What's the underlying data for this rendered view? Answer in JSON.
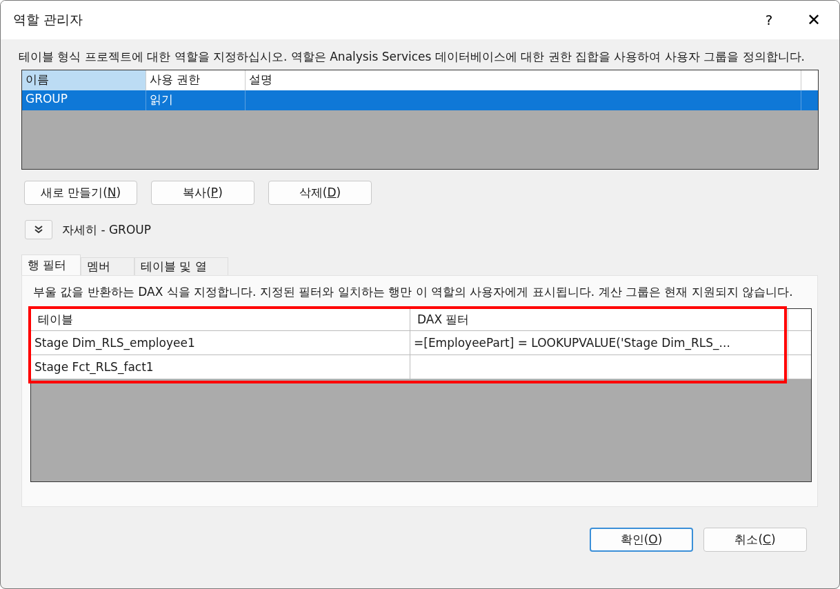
{
  "window": {
    "title": "역할 관리자",
    "help": "?",
    "close": "✕"
  },
  "description": "테이블 형식 프로젝트에 대한 역할을 지정하십시오. 역할은 Analysis Services 데이터베이스에 대한 권한 집합을 사용하여 사용자 그룹을 정의합니다.",
  "roles": {
    "columns": [
      {
        "label": "이름",
        "selected": true
      },
      {
        "label": "사용 권한",
        "selected": false
      },
      {
        "label": "설명",
        "selected": false
      }
    ],
    "rows": [
      {
        "cells": [
          "GROUP",
          "읽기",
          ""
        ],
        "selected": true
      }
    ]
  },
  "role_buttons": [
    {
      "label": "새로 만들기(N)"
    },
    {
      "label": "복사(P)"
    },
    {
      "label": "삭제(D)"
    }
  ],
  "details": {
    "expanded": true,
    "label": "자세히 - GROUP"
  },
  "tabs": [
    {
      "label": "행 필터",
      "selected": true
    },
    {
      "label": "멤버",
      "selected": false
    },
    {
      "label": "테이블 및 열",
      "selected": false
    }
  ],
  "filter_description": "부울 값을 반환하는 DAX 식을 지정합니다. 지정된 필터와 일치하는 행만 이 역할의 사용자에게 표시됩니다. 계산 그룹은 현재 지원되지 않습니다.",
  "filters": {
    "highlighted": true,
    "columns": [
      "테이블",
      "DAX 필터"
    ],
    "rows": [
      {
        "cells": [
          "Stage Dim_RLS_employee1",
          "=[EmployeePart] = LOOKUPVALUE('Stage Dim_RLS_..."
        ]
      },
      {
        "cells": [
          "Stage Fct_RLS_fact1",
          ""
        ]
      }
    ]
  },
  "footer_buttons": [
    {
      "label": "확인(O)",
      "default": true
    },
    {
      "label": "취소(C)",
      "default": false
    }
  ]
}
